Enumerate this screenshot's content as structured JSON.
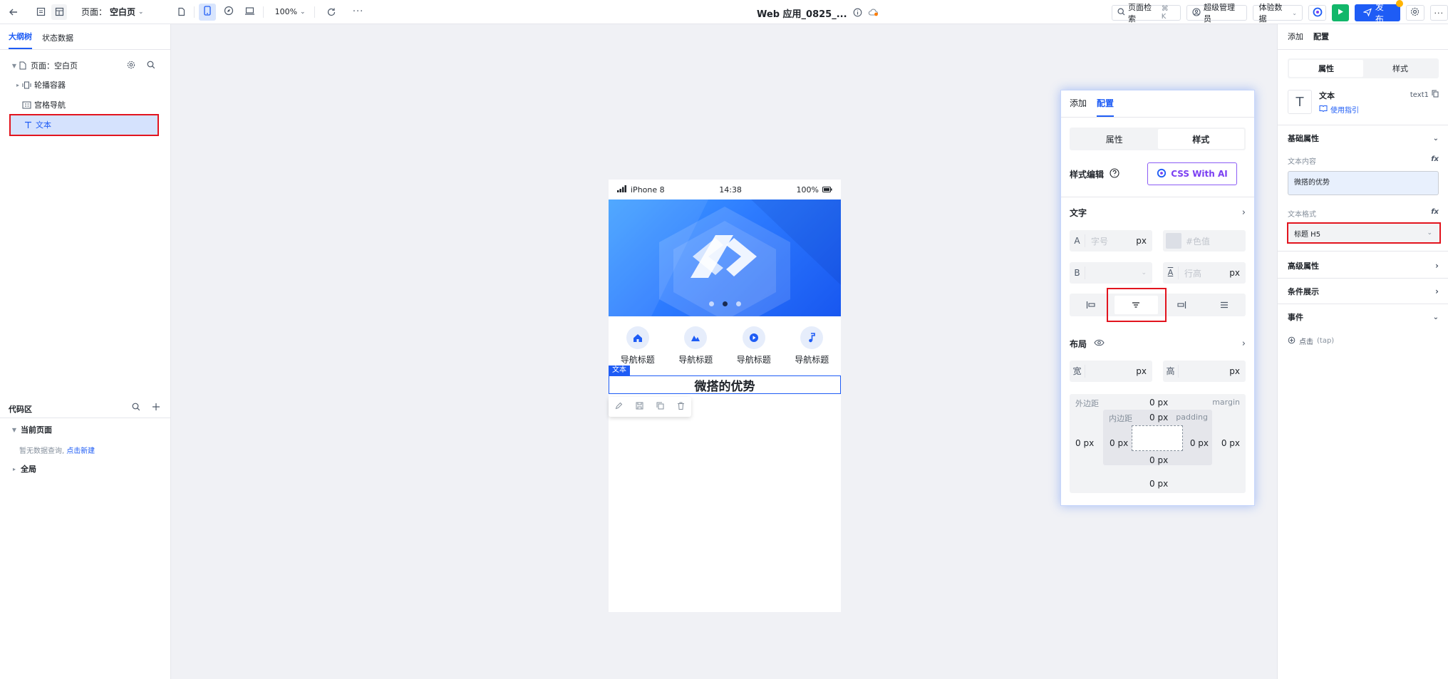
{
  "topbar": {
    "page_label": "页面：",
    "page_name": "空白页",
    "zoom": "100%",
    "app_title": "Web 应用_0825_...",
    "search_label": "页面检索",
    "search_kbd": "⌘ K",
    "admin_label": "超级管理员",
    "experience_label": "体验数据",
    "publish_label": "发布"
  },
  "left": {
    "tabs": [
      "大纲树",
      "状态数据"
    ],
    "tree": {
      "page_label": "页面：空白页",
      "items": [
        "轮播容器",
        "宫格导航",
        "文本"
      ]
    },
    "code": {
      "title": "代码区",
      "current_page": "当前页面",
      "empty_text": "暂无数据查询,",
      "create_link": "点击新建",
      "global": "全局"
    }
  },
  "canvas": {
    "status": {
      "carrier": "iPhone 8",
      "time": "14:38",
      "battery": "100%"
    },
    "nav_items": [
      "导航标题",
      "导航标题",
      "导航标题",
      "导航标题"
    ],
    "text_tag": "文本",
    "text_content": "微搭的优势"
  },
  "float_panel": {
    "tabs": [
      "添加",
      "配置"
    ],
    "seg": [
      "属性",
      "样式"
    ],
    "style_edit": "样式编辑",
    "ai_button": "CSS With AI",
    "text_section": "文字",
    "font_size_pre": "A",
    "font_size_placeholder": "字号",
    "unit_px": "px",
    "color_placeholder": "#色值",
    "bold_pre": "B",
    "line_height_placeholder": "行高",
    "layout_section": "布局",
    "width_pre": "宽",
    "height_pre": "高",
    "margin_label": "外边距",
    "margin_en": "margin",
    "padding_label": "内边距",
    "padding_en": "padding",
    "zero_px": "0 px"
  },
  "right": {
    "tabs": [
      "添加",
      "配置"
    ],
    "seg": [
      "属性",
      "样式"
    ],
    "comp_name": "文本",
    "comp_id": "text1",
    "guide_link": "使用指引",
    "basic_props": "基础属性",
    "text_content_label": "文本内容",
    "text_content_value": "微搭的优势",
    "text_format_label": "文本格式",
    "text_format_value": "标题 H5",
    "advanced_props": "高级属性",
    "condition_show": "条件展示",
    "events": "事件",
    "event_click": "点击",
    "event_click_en": "(tap)",
    "fx": "fx"
  },
  "colors": {
    "accent": "#1e5cf5",
    "highlight_red": "#e2141e",
    "run_green": "#12b76a",
    "ai_purple": "#7b3ff2"
  }
}
